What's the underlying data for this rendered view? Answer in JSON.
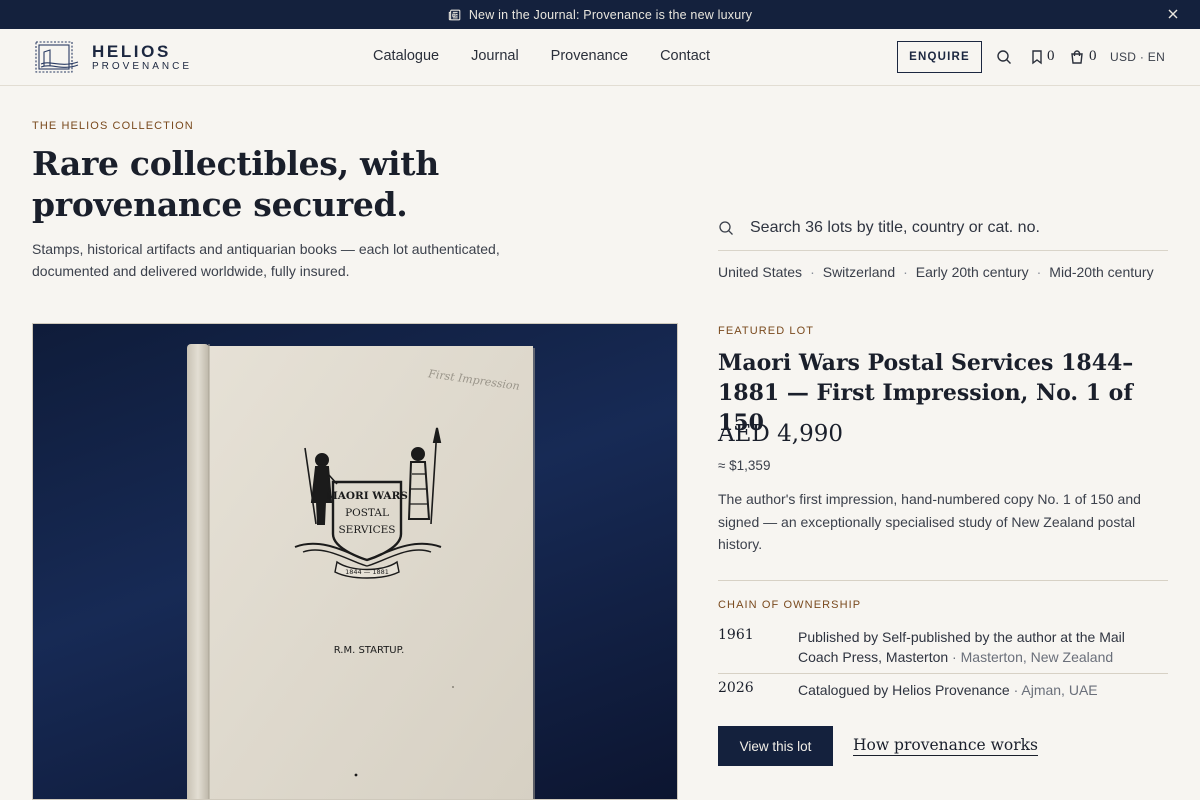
{
  "announcement": {
    "icon": "newspaper-icon",
    "text": "New in the Journal: Provenance is the new luxury",
    "close_icon": "close-icon"
  },
  "brand": {
    "name": "HELIOS",
    "sub": "PROVENANCE",
    "logo_icon": "stamp-logo-icon"
  },
  "nav": {
    "items": [
      "Catalogue",
      "Journal",
      "Provenance",
      "Contact"
    ]
  },
  "header": {
    "enquire_label": "ENQUIRE",
    "search_icon": "search-icon",
    "saved_icon": "bookmark-icon",
    "saved_count": "0",
    "cart_icon": "bag-icon",
    "cart_count": "0",
    "locale": "USD · EN"
  },
  "hero": {
    "eyebrow": "THE HELIOS COLLECTION",
    "title": "Rare collectibles, with provenance secured.",
    "lede": "Stamps, historical artifacts and antiquarian books — each lot authenticated, documented and delivered worldwide, fully insured."
  },
  "search": {
    "placeholder": "Search 36 lots by title, country or cat. no.",
    "value": ""
  },
  "filters": {
    "chips": [
      "United States",
      "Switzerland",
      "Early 20th century",
      "Mid-20th century"
    ]
  },
  "featured": {
    "eyebrow": "FEATURED LOT",
    "title": "Maori Wars Postal Services 1844–1881 — First Impression, No. 1 of 150",
    "price": "AED 4,990",
    "price_conversion": "≈ $1,359",
    "description": "The author's first impression, hand-numbered copy No. 1 of 150 and signed — an exceptionally specialised study of New Zealand postal history.",
    "image": {
      "crest_line1": "MAORI WARS",
      "crest_line2": "POSTAL",
      "crest_line3": "SERVICES",
      "crest_dates": "1844 — 1881",
      "author": "R.M. STARTUP.",
      "inscription": "First Impression"
    }
  },
  "chain": {
    "eyebrow": "CHAIN OF OWNERSHIP",
    "entries": [
      {
        "year": "1961",
        "text": "Published by Self-published by the author at the Mail Coach Press, Masterton",
        "location": "Masterton, New Zealand"
      },
      {
        "year": "2026",
        "text": "Catalogued by Helios Provenance",
        "location": "Ajman, UAE"
      }
    ],
    "separator": " · "
  },
  "cta": {
    "primary": "View this lot",
    "secondary": "How provenance works"
  },
  "colors": {
    "navy": "#14213d",
    "accent_brown": "#7a4a1e",
    "background": "#f7f5f1"
  }
}
